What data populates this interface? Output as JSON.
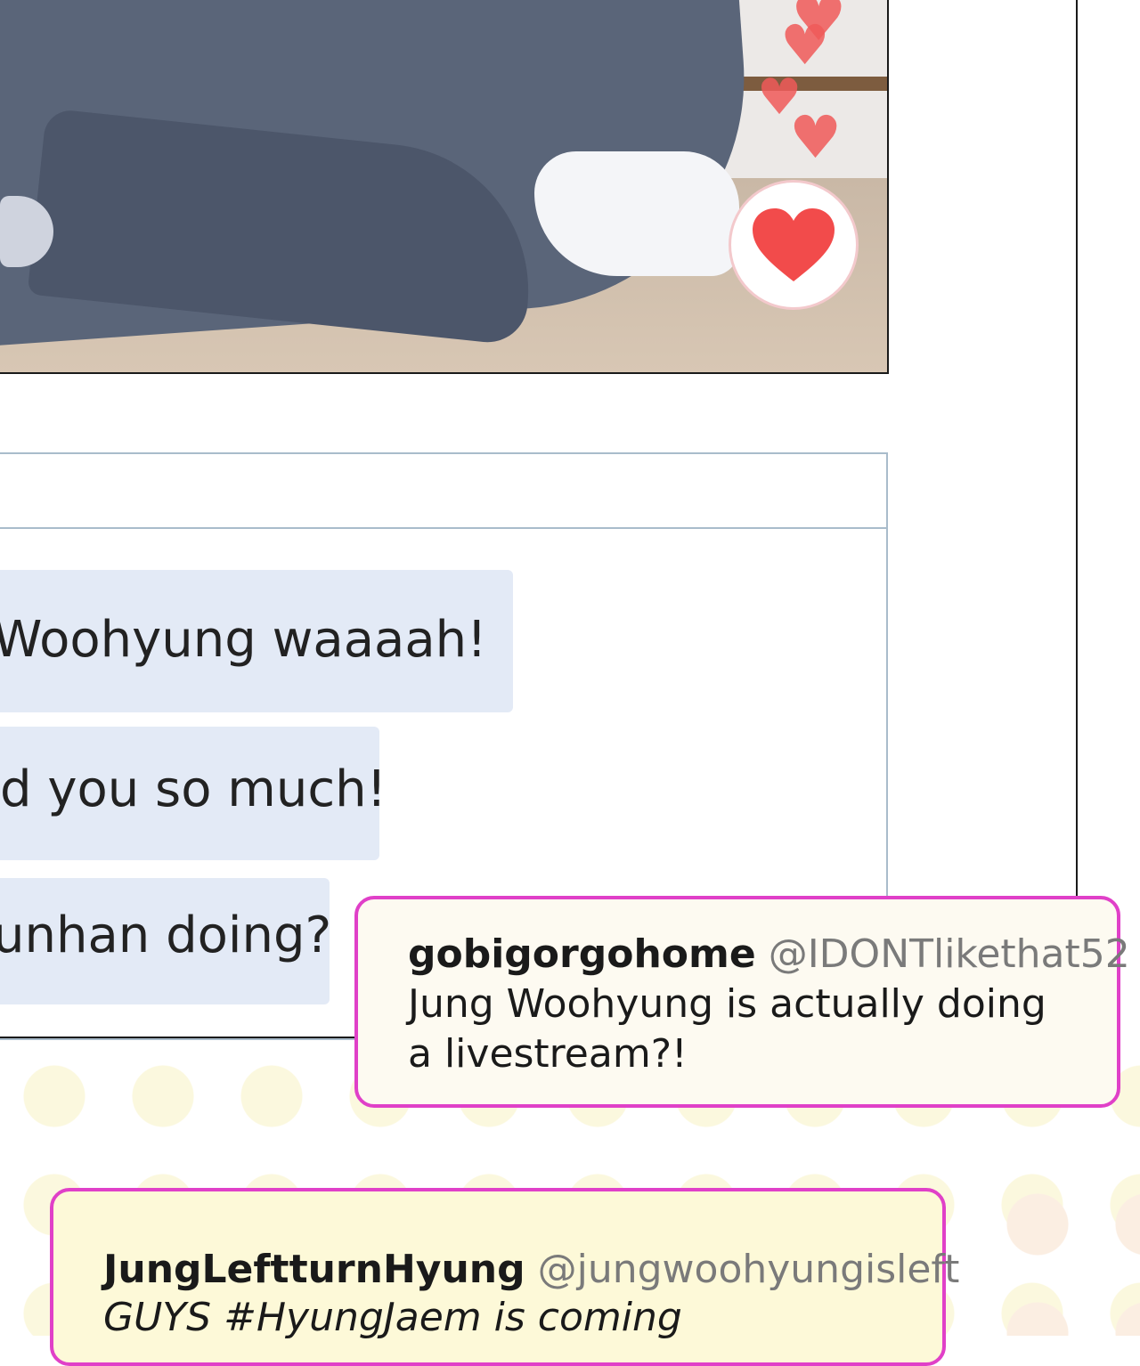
{
  "scene": {
    "like_icon": "heart-icon",
    "floating_hearts": [
      "heart-icon",
      "heart-icon",
      "heart-icon",
      "heart-icon"
    ]
  },
  "chat": {
    "messages": [
      {
        "text": "Woohyung waaaah!"
      },
      {
        "text": "d you so much!"
      },
      {
        "text": "unhan doing?"
      }
    ]
  },
  "comments": [
    {
      "username": "gobigorgohome",
      "handle": "@IDONTlikethat52",
      "lines": [
        "Jung Woohyung is actually doing",
        "a livestream?!"
      ]
    },
    {
      "username": "JungLeftturnHyung",
      "handle": "@jungwoohyungisleft",
      "lines": [
        "GUYS #HyungJaem  is  coming"
      ]
    }
  ],
  "colors": {
    "accent_border": "#e040c8",
    "heart": "#f05a5a",
    "bubble": "#e3eaf6",
    "comment1_bg": "#fdfaf1",
    "comment2_bg": "#fdf9d8"
  }
}
